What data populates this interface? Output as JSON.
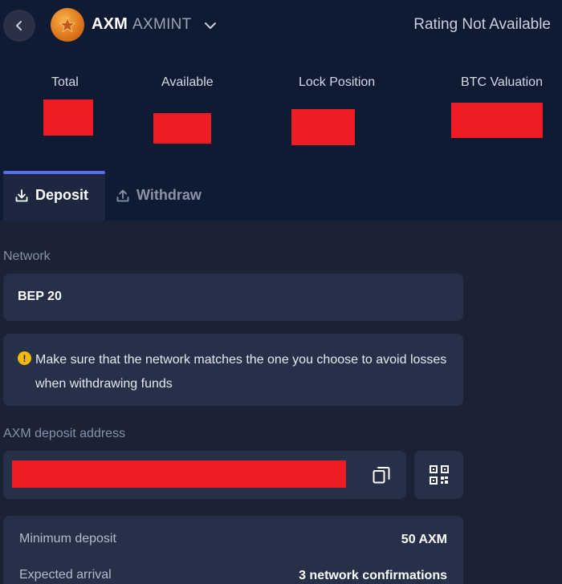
{
  "header": {
    "coin_symbol": "AXM",
    "coin_name": "AXMINT",
    "rating": "Rating Not Available"
  },
  "stats": [
    {
      "label": "Total",
      "value": "redacted"
    },
    {
      "label": "Available",
      "value": "redacted"
    },
    {
      "label": "Lock Position",
      "value": "redacted"
    },
    {
      "label": "BTC Valuation",
      "value": "redacted"
    }
  ],
  "tabs": {
    "deposit": "Deposit",
    "withdraw": "Withdraw",
    "active": "deposit"
  },
  "network": {
    "label": "Network",
    "value": "BEP 20"
  },
  "warning": {
    "text": "Make sure that the network matches the one you choose to avoid losses when withdrawing funds"
  },
  "address": {
    "label": "AXM deposit address",
    "value": "redacted"
  },
  "details": {
    "min_deposit_label": "Minimum deposit",
    "min_deposit_value": "50 AXM",
    "arrival_label": "Expected arrival",
    "arrival_value": "3 network confirmations"
  },
  "colors": {
    "background": "#1b2236",
    "top_background": "#0f1a33",
    "card": "#273049",
    "accent": "#5b6cf0",
    "warning": "#f0b90b",
    "redaction": "#ee1c25"
  },
  "icons": {
    "back": "chevron-left-icon",
    "coin_dropdown": "chevron-down-icon",
    "deposit": "download-icon",
    "withdraw": "upload-icon",
    "warning": "exclamation-icon",
    "copy": "copy-icon",
    "qr": "qr-code-icon"
  }
}
